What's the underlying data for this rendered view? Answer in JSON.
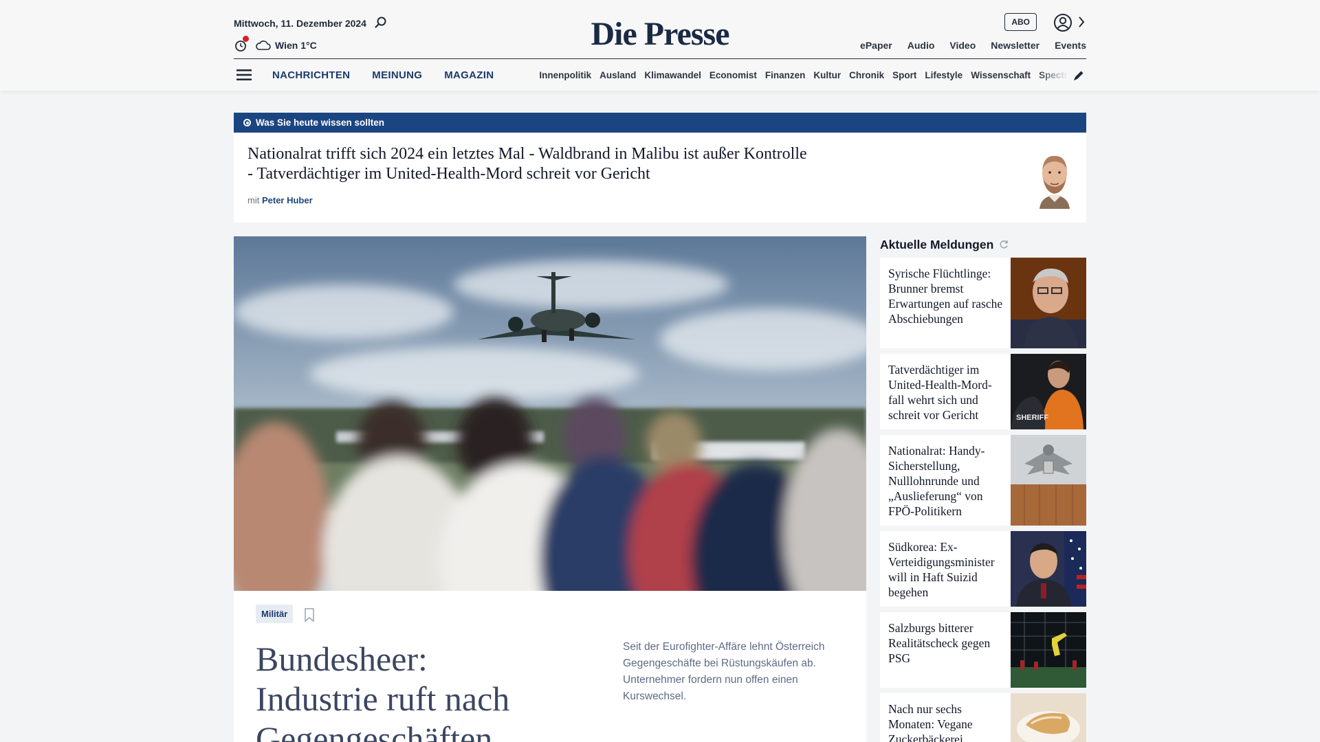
{
  "header": {
    "date": "Mittwoch, 11. Dezember 2024",
    "weather": "Wien 1°C",
    "logo": "Die Presse",
    "abo_label": "ABO",
    "top_links": [
      "ePaper",
      "Audio",
      "Video",
      "Newsletter",
      "Events"
    ],
    "main_nav": [
      "NACHRICHTEN",
      "MEINUNG",
      "MAGAZIN"
    ],
    "sub_nav": [
      "Innenpolitik",
      "Ausland",
      "Klimawandel",
      "Economist",
      "Finanzen",
      "Kultur",
      "Chronik",
      "Sport",
      "Lifestyle",
      "Wissenschaft",
      "Spectrum"
    ]
  },
  "briefing": {
    "label": "Was Sie heute wissen sollten",
    "title": "Nationalrat trifft sich 2024 ein letztes Mal - Waldbrand in Malibu ist außer Kontrolle - Tatverdächtiger im United-Health-Mord schreit vor Gericht",
    "author_prefix": "mit",
    "author": "Peter Huber"
  },
  "hero": {
    "tag": "Militär",
    "title": "Bundesheer: Industrie ruft nach Gegengeschäften",
    "lead": "Seit der Eurofighter-Affäre lehnt Österreich Gegengeschäfte bei Rüstungskäufen ab. Unternehmer fordern nun offen einen Kurswechsel."
  },
  "sidebar": {
    "title": "Aktuelle Meldungen",
    "items": [
      {
        "title": "Syrische Flüchtlinge: Brunner bremst Erwartungen auf rasche Abschiebungen"
      },
      {
        "title": "Tatverdächtiger im United-Health-Mord­fall wehrt sich und schreit vor Gericht"
      },
      {
        "title": "Nationalrat: Handy-Sicherstellung, Nulllohnrunde und „Auslieferung“ von FPÖ-Politikern"
      },
      {
        "title": "Südkorea: Ex-Verteidigungsminister will in Haft Suizid begehen"
      },
      {
        "title": "Salzburgs bitterer Realitätscheck gegen PSG"
      },
      {
        "title": "Nach nur sechs Monaten: Vegane Zuckerbäckerei"
      }
    ]
  },
  "colors": {
    "brand_blue": "#1b4581",
    "nav_blue": "#1b3a6b",
    "notification_red": "#d61f26"
  }
}
